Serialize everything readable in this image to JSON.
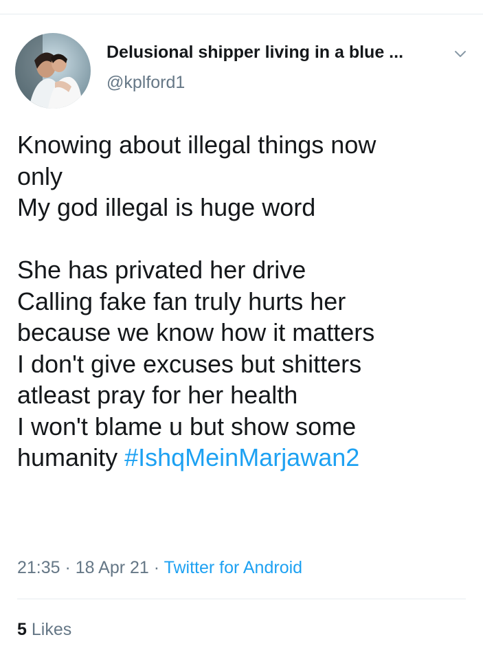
{
  "user": {
    "display_name": "Delusional shipper living in a blue ...",
    "handle": "@kplford1"
  },
  "tweet": {
    "lines": [
      "Knowing about illegal things now",
      "only",
      "My god illegal is huge word",
      "",
      "She has privated her drive",
      "Calling fake fan truly hurts her",
      "because we know how it matters",
      "I don't give excuses but shitters",
      "atleast pray for her health",
      "I won't blame u but show some"
    ],
    "last_line_text": "humanity",
    "hashtag": "#IshqMeinMarjawan2"
  },
  "meta": {
    "time": "21:35",
    "date": "18 Apr 21",
    "separator": " · ",
    "source": "Twitter for Android"
  },
  "likes": {
    "count": "5",
    "label": "Likes"
  },
  "icons": {
    "avatar": "profile-photo-avatar",
    "menu": "chevron-down-icon"
  },
  "colors": {
    "link": "#1da1f2",
    "text": "#14171a",
    "muted": "#657786"
  }
}
